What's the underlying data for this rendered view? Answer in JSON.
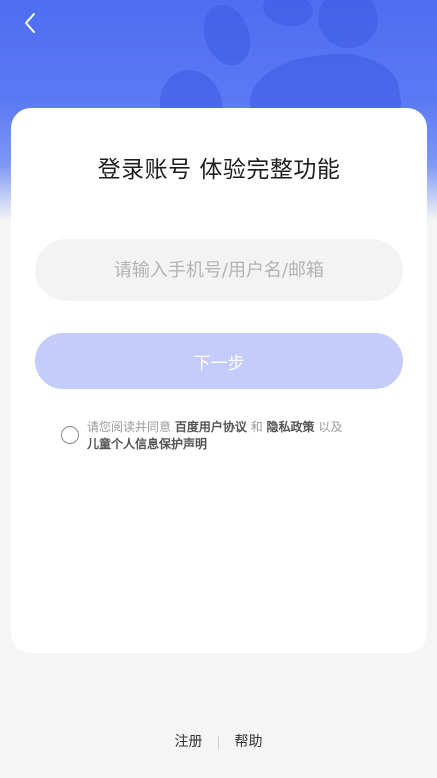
{
  "header": {
    "back_icon": "chevron-left-icon"
  },
  "login": {
    "title": "登录账号 体验完整功能",
    "account_placeholder": "请输入手机号/用户名/邮箱",
    "account_value": "",
    "next_label": "下一步"
  },
  "agreement": {
    "checked": false,
    "prefix": "请您阅读并同意",
    "user_agreement": "百度用户协议",
    "and": "和",
    "privacy_policy": "隐私政策",
    "and_also": "以及",
    "child_privacy": "儿童个人信息保护声明"
  },
  "footer": {
    "register": "注册",
    "separator": "|",
    "help": "帮助"
  },
  "colors": {
    "header_blue": "#4f6df2",
    "button_disabled": "#c3ccfa",
    "input_bg": "#f3f3f4"
  }
}
